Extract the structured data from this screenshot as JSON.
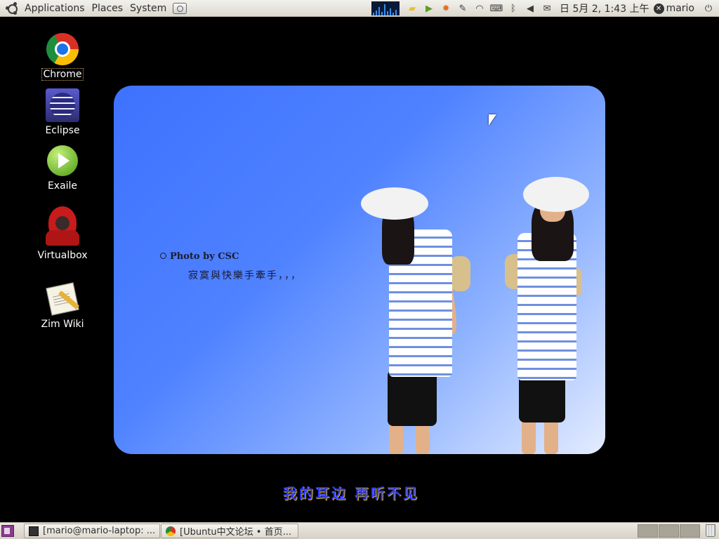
{
  "top_panel": {
    "menus": [
      "Applications",
      "Places",
      "System"
    ],
    "clock": "日 5月 2, 1:43 上午",
    "user": "mario"
  },
  "desktop_icons": [
    {
      "label": "Chrome"
    },
    {
      "label": "Eclipse"
    },
    {
      "label": "Exaile"
    },
    {
      "label": "Virtualbox"
    },
    {
      "label": "Zim Wiki"
    }
  ],
  "wallpaper": {
    "credit": "Photo by CSC",
    "poem": "寂寞與快樂手牽手，，，",
    "caption": "我的耳边 再听不见"
  },
  "taskbar": {
    "tasks": [
      {
        "label": "[mario@mario-laptop: ...",
        "icon": "terminal-icon"
      },
      {
        "label": "[Ubuntu中文论坛 • 首页...",
        "icon": "chrome-icon"
      }
    ],
    "workspaces": 4
  }
}
